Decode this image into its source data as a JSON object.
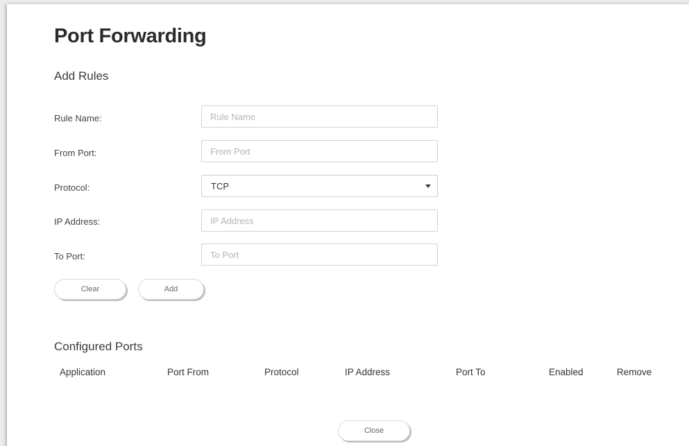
{
  "page": {
    "title": "Port Forwarding"
  },
  "add_rules": {
    "section_title": "Add Rules",
    "fields": {
      "rule_name": {
        "label": "Rule Name:",
        "placeholder": "Rule Name",
        "value": ""
      },
      "from_port": {
        "label": "From Port:",
        "placeholder": "From Port",
        "value": ""
      },
      "protocol": {
        "label": "Protocol:",
        "selected": "TCP"
      },
      "ip_address": {
        "label": "IP Address:",
        "placeholder": "IP Address",
        "value": ""
      },
      "to_port": {
        "label": "To Port:",
        "placeholder": "To Port",
        "value": ""
      }
    },
    "buttons": {
      "clear": "Clear",
      "add": "Add"
    }
  },
  "configured_ports": {
    "section_title": "Configured Ports",
    "columns": [
      "Application",
      "Port From",
      "Protocol",
      "IP Address",
      "Port To",
      "Enabled",
      "Remove"
    ],
    "rows": []
  },
  "footer": {
    "close": "Close"
  }
}
